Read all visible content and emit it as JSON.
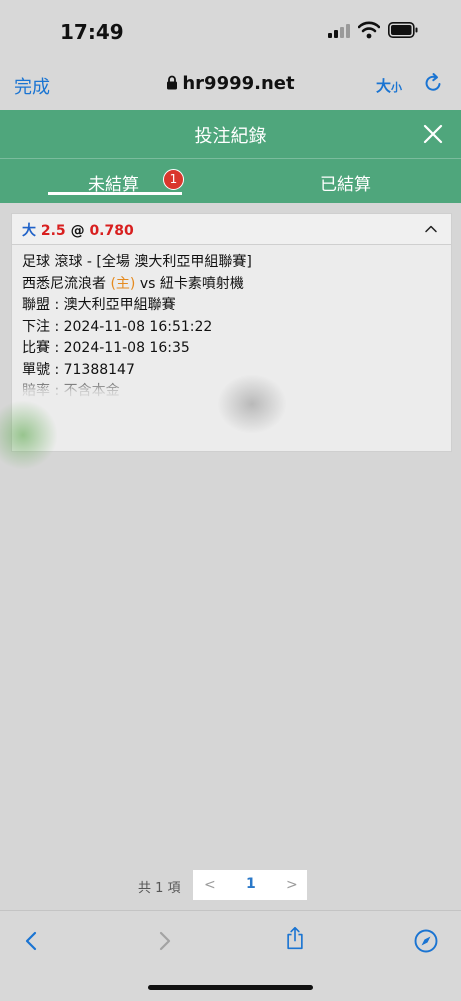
{
  "status_bar": {
    "time": "17:49"
  },
  "browser": {
    "done_label": "完成",
    "url": "hr9999.net",
    "text_size_big": "大",
    "text_size_small": "小"
  },
  "header": {
    "title": "投注紀錄"
  },
  "tabs": {
    "unsettled": {
      "label": "未結算",
      "badge": "1"
    },
    "settled": {
      "label": "已結算"
    }
  },
  "bet": {
    "ou_label": "大",
    "line": "2.5",
    "at": "@",
    "odds": "0.780",
    "sport_line": "足球 滾球 - [全場 澳大利亞甲組聯賽]",
    "home_team": "西悉尼流浪者",
    "home_tag": "(主)",
    "vs": "vs",
    "away_team": "紐卡素噴射機",
    "league": "聯盟 : 澳大利亞甲組聯賽",
    "bet_time": "下注 : 2024-11-08 16:51:22",
    "match_time": "比賽 : 2024-11-08 16:35",
    "ticket_no": "單號 : 71388147",
    "odds_type": "賠率 : 不含本金"
  },
  "pagination": {
    "total": "共 1 項",
    "prev": "<",
    "page": "1",
    "next": ">"
  },
  "colors": {
    "header_green": "#4fa67c",
    "link_blue": "#1a74d2",
    "odds_red": "#d81f1f",
    "badge_red": "#d9372c",
    "home_orange": "#e58a1e"
  },
  "icons": [
    "lock-icon",
    "reload-icon",
    "close-icon",
    "chevron-up-icon",
    "back-icon",
    "forward-icon",
    "share-icon",
    "compass-icon"
  ]
}
